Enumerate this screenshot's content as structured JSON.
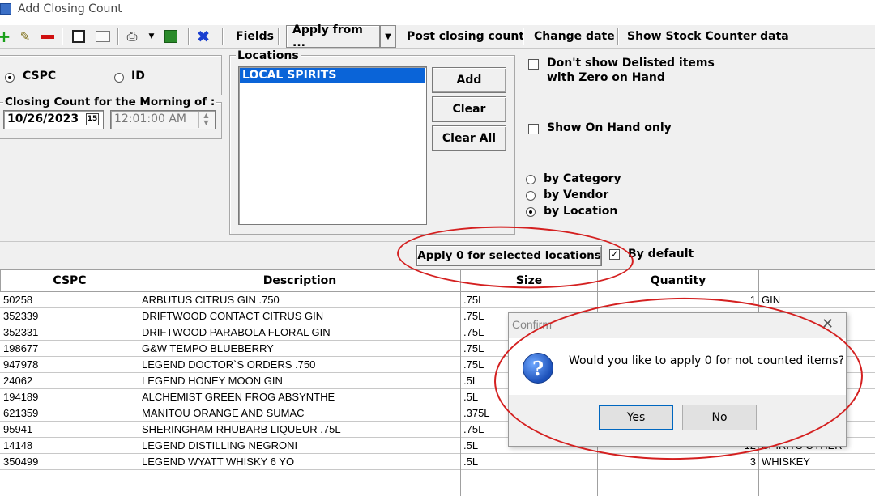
{
  "window": {
    "title": "Add Closing Count"
  },
  "toolbar": {
    "fields_label": "Fields",
    "apply_from_label": "Apply from ...",
    "post_closing_label": "Post closing count",
    "change_date_label": "Change date",
    "show_stock_label": "Show Stock Counter data"
  },
  "id_mode": {
    "cspc_label": "CSPC",
    "id_label": "ID",
    "selected": "CSPC"
  },
  "closing_count": {
    "group_label": "Closing Count for the Morning of :",
    "date": "10/26/2023",
    "time": "12:01:00 AM"
  },
  "locations": {
    "group_label": "Locations",
    "items": [
      "LOCAL SPIRITS"
    ],
    "add_label": "Add",
    "clear_label": "Clear",
    "clear_all_label": "Clear All"
  },
  "options": {
    "dont_show_delisted_line1": "Don't show Delisted items",
    "dont_show_delisted_line2": "with Zero on Hand",
    "show_on_hand_only": "Show On Hand only",
    "by_category": "by Category",
    "by_vendor": "by Vendor",
    "by_location": "by Location",
    "selected_grouping": "by Location"
  },
  "apply_zero": {
    "button_label": "Apply 0 for selected locations",
    "by_default_label": "By default",
    "by_default_checked": true
  },
  "grid": {
    "columns": [
      "CSPC",
      "Description",
      "Size",
      "Quantity",
      ""
    ],
    "rows": [
      {
        "cspc": "50258",
        "description": "ARBUTUS CITRUS GIN .750",
        "size": ".75L",
        "quantity": "1",
        "category": "GIN"
      },
      {
        "cspc": "352339",
        "description": "DRIFTWOOD CONTACT CITRUS GIN",
        "size": ".75L",
        "quantity": "",
        "category": ""
      },
      {
        "cspc": "352331",
        "description": "DRIFTWOOD PARABOLA FLORAL GIN",
        "size": ".75L",
        "quantity": "",
        "category": ""
      },
      {
        "cspc": "198677",
        "description": "G&W TEMPO BLUEBERRY",
        "size": ".75L",
        "quantity": "",
        "category": ""
      },
      {
        "cspc": "947978",
        "description": "LEGEND DOCTOR`S ORDERS .750",
        "size": ".75L",
        "quantity": "",
        "category": ""
      },
      {
        "cspc": "24062",
        "description": "LEGEND HONEY MOON GIN",
        "size": ".5L",
        "quantity": "",
        "category": ""
      },
      {
        "cspc": "194189",
        "description": "ALCHEMIST GREEN FROG ABSYNTHE",
        "size": ".5L",
        "quantity": "",
        "category": ""
      },
      {
        "cspc": "621359",
        "description": "MANITOU ORANGE AND SUMAC",
        "size": ".375L",
        "quantity": "",
        "category": ""
      },
      {
        "cspc": "95941",
        "description": "SHERINGHAM RHUBARB LIQUEUR .75L",
        "size": ".75L",
        "quantity": "",
        "category": ""
      },
      {
        "cspc": "14148",
        "description": "LEGEND DISTILLING NEGRONI",
        "size": ".5L",
        "quantity": "12",
        "category": "SPIRITS OTHER"
      },
      {
        "cspc": "350499",
        "description": "LEGEND WYATT WHISKY 6 YO",
        "size": ".5L",
        "quantity": "3",
        "category": "WHISKEY"
      }
    ]
  },
  "dialog": {
    "title": "Confirm",
    "message": "Would you like to apply 0 for not counted items?",
    "yes_label": "Yes",
    "no_label": "No"
  }
}
